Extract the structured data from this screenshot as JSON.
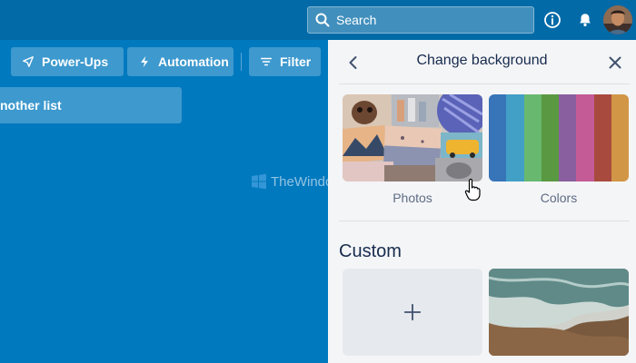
{
  "header": {
    "search": {
      "placeholder": "Search"
    },
    "icons": [
      "search-icon",
      "info-icon",
      "bell-icon",
      "avatar"
    ]
  },
  "board": {
    "buttons": {
      "power_ups": "Power-Ups",
      "automation": "Automation",
      "filter": "Filter"
    },
    "add_list": "nother list"
  },
  "watermark": {
    "text": "TheWindowsClub"
  },
  "panel": {
    "title": "Change background",
    "options": [
      {
        "label": "Photos"
      },
      {
        "label": "Colors"
      }
    ],
    "custom_title": "Custom",
    "swatches": [
      "#3774b8",
      "#42a0c7",
      "#68b96f",
      "#5a9942",
      "#8a5fa0",
      "#c45b97",
      "#a84b3e",
      "#d19646"
    ]
  },
  "colors": {
    "header": "#026aa7",
    "board": "#0079bf",
    "panel": "#f4f5f7"
  }
}
